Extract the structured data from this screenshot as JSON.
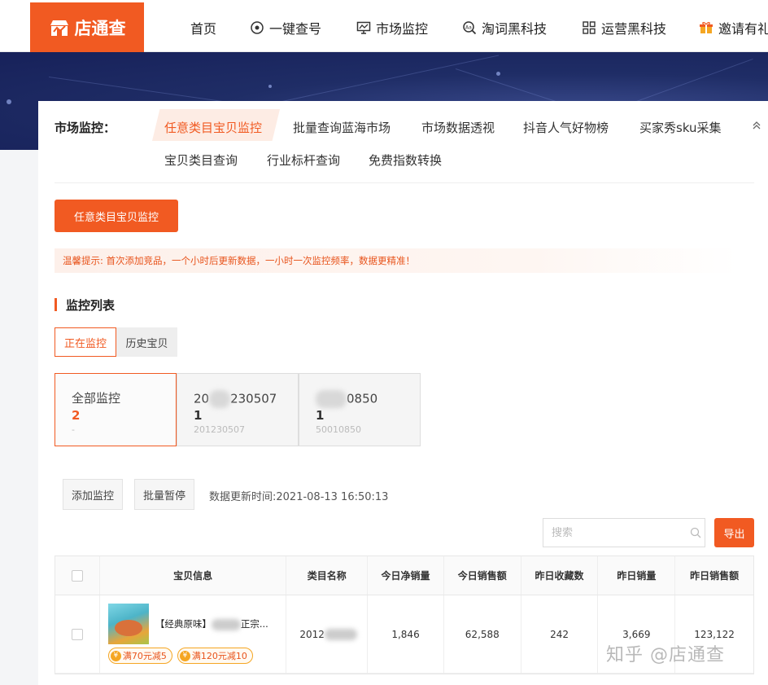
{
  "brand": {
    "name": "店通查"
  },
  "nav": [
    {
      "label": "首页",
      "icon": ""
    },
    {
      "label": "一键查号",
      "icon": "eye-icon"
    },
    {
      "label": "市场监控",
      "icon": "monitor-icon"
    },
    {
      "label": "淘词黑科技",
      "icon": "search-word-icon"
    },
    {
      "label": "运营黑科技",
      "icon": "grid-icon"
    },
    {
      "label": "邀请有礼",
      "icon": "gift-icon"
    }
  ],
  "subnav": {
    "title": "市场监控：",
    "row1": [
      "任意类目宝贝监控",
      "批量查询蓝海市场",
      "市场数据透视",
      "抖音人气好物榜",
      "买家秀sku采集"
    ],
    "row2": [
      "宝贝类目查询",
      "行业标杆查询",
      "免费指数转换"
    ]
  },
  "primary_button": "任意类目宝贝监控",
  "tip": "温馨提示: 首次添加竞品，一个小时后更新数据，一小时一次监控频率，数据更精准！",
  "section_title": "监控列表",
  "segments": [
    "正在监控",
    "历史宝贝"
  ],
  "cards": [
    {
      "title": "全部监控",
      "count": "2",
      "sub": "-"
    },
    {
      "title_prefix": "20",
      "title_suffix": "230507",
      "count": "1",
      "sub": "201230507"
    },
    {
      "title_prefix": "",
      "title_suffix": "0850",
      "count": "1",
      "sub": "50010850"
    }
  ],
  "actions": {
    "add": "添加监控",
    "pause": "批量暂停",
    "update_time": "数据更新时间:2021-08-13 16:50:13"
  },
  "search": {
    "placeholder": "搜索"
  },
  "export_label": "导出",
  "table": {
    "headers": [
      "宝贝信息",
      "类目名称",
      "今日净销量",
      "今日销售额",
      "昨日收藏数",
      "昨日销量",
      "昨日销售额"
    ],
    "rows": [
      {
        "name_prefix": "【经典原味】",
        "name_suffix": "正宗...",
        "coupons": [
          "满70元减5",
          "满120元减10"
        ],
        "category_prefix": "2012",
        "today_net_sales": "1,846",
        "today_revenue": "62,588",
        "yesterday_favorites": "242",
        "yesterday_sales": "3,669",
        "yesterday_revenue": "123,122"
      }
    ]
  },
  "watermark": "知乎 @店通查",
  "colors": {
    "accent": "#f15a22",
    "hero": "#1f2d66"
  }
}
